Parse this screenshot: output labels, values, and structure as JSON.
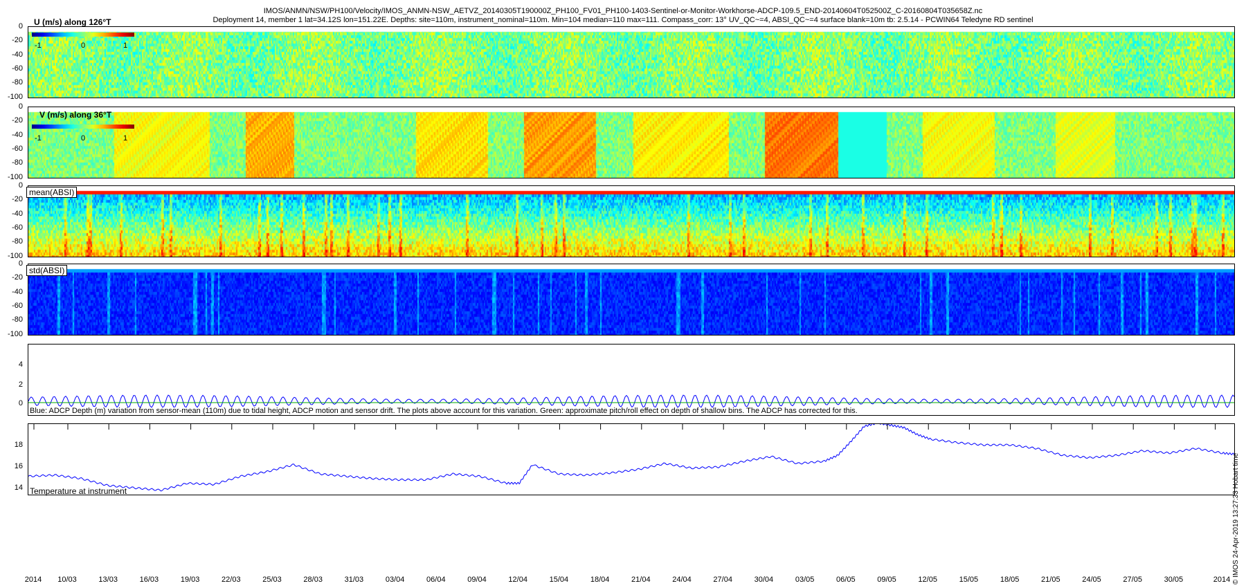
{
  "title_line1": "IMOS/ANMN/NSW/PH100/Velocity/IMOS_ANMN-NSW_AETVZ_20140305T190000Z_PH100_FV01_PH100-1403-Sentinel-or-Monitor-Workhorse-ADCP-109.5_END-20140604T052500Z_C-20160804T035658Z.nc",
  "title_line2": "Deployment 14, member 1 lat=34.12S lon=151.22E. Depths: site=110m, instrument_nominal=110m. Min=104 median=110 max=111. Compass_corr: 13° UV_QC~=4, ABSI_QC~=4 surface blank=10m tb: 2.5.14 - PCWIN64 Teledyne RD sentinel",
  "side_note": "© IMOS 24-Apr-2019 13:27:33 Hobart time",
  "panels": {
    "u": {
      "label": "U (m/s) along 126°T",
      "cbar_ticks": [
        "-1",
        "0",
        "1"
      ]
    },
    "v": {
      "label": "V (m/s) along 36°T",
      "cbar_ticks": [
        "-1",
        "0",
        "1"
      ]
    },
    "mean": {
      "label": "mean(ABSI)"
    },
    "std": {
      "label": "std(ABSI)"
    }
  },
  "depth_ticks": [
    "0",
    "-20",
    "-40",
    "-60",
    "-80",
    "-100"
  ],
  "depth_panel_ticks": [
    "4",
    "2",
    "0"
  ],
  "depth_caption": "Blue: ADCP Depth (m) variation from sensor-mean (110m) due to tidal height, ADCP motion and sensor drift. The plots above account for this variation. Green: approximate pitch/roll effect on depth of shallow bins. The ADCP has corrected for this.",
  "temp_panel_ticks": [
    "18",
    "16",
    "14"
  ],
  "temp_caption": "Temperature at instrument",
  "x_ticks": [
    "2014",
    "10/03",
    "13/03",
    "16/03",
    "19/03",
    "22/03",
    "25/03",
    "28/03",
    "31/03",
    "03/04",
    "06/04",
    "09/04",
    "12/04",
    "15/04",
    "18/04",
    "21/04",
    "24/04",
    "27/04",
    "30/04",
    "03/05",
    "06/05",
    "09/05",
    "12/05",
    "15/05",
    "18/05",
    "21/05",
    "24/05",
    "27/05",
    "30/05",
    "2014"
  ],
  "chart_data": [
    {
      "type": "heatmap",
      "title": "U (m/s) along 126°T",
      "ylim": [
        -100,
        0
      ],
      "clim": [
        -1,
        1
      ],
      "colormap": "jet",
      "note": "mostly near 0 (green) throughout"
    },
    {
      "type": "heatmap",
      "title": "V (m/s) along 36°T",
      "ylim": [
        -100,
        0
      ],
      "clim": [
        -1,
        1
      ],
      "colormap": "jet",
      "note": "episodic positive (yellow/orange) bands"
    },
    {
      "type": "heatmap",
      "title": "mean(ABSI)",
      "ylim": [
        -100,
        0
      ],
      "colormap": "jet"
    },
    {
      "type": "heatmap",
      "title": "std(ABSI)",
      "ylim": [
        -100,
        0
      ],
      "colormap": "jet"
    },
    {
      "type": "line",
      "ylabel": "",
      "ylim": [
        -1.2,
        5.5
      ],
      "series": [
        {
          "color": "#0000ff",
          "note": "tidal oscillation amplitude ~0.5-0.8 m around 0"
        },
        {
          "color": "#00aa00",
          "note": "near 0"
        }
      ]
    },
    {
      "type": "line",
      "ylim": [
        13.5,
        19.7
      ],
      "x_days": [
        0,
        2,
        4,
        6,
        8,
        10,
        12,
        14,
        16,
        18,
        20,
        22,
        24,
        26,
        28,
        30,
        32,
        34,
        36,
        37,
        38,
        40,
        42,
        44,
        46,
        48,
        50,
        52,
        54,
        56,
        58,
        60,
        61,
        62,
        63,
        64,
        65,
        66,
        67,
        68,
        70,
        72,
        74,
        76,
        78,
        80,
        82,
        84,
        86,
        88,
        90,
        91
      ],
      "values": [
        15.2,
        15.3,
        15.0,
        14.4,
        14.2,
        14.0,
        14.6,
        14.5,
        15.2,
        15.6,
        16.2,
        15.4,
        15.2,
        15.0,
        14.9,
        14.9,
        15.4,
        15.2,
        14.6,
        14.6,
        16.2,
        15.4,
        15.3,
        15.5,
        15.8,
        16.3,
        15.9,
        16.0,
        16.5,
        16.9,
        16.3,
        16.5,
        17.0,
        18.2,
        19.5,
        19.8,
        19.6,
        19.4,
        18.8,
        18.4,
        18.1,
        17.9,
        17.9,
        17.6,
        17.0,
        16.8,
        17.0,
        17.4,
        17.2,
        17.6,
        17.2,
        17.1
      ],
      "series_color": "#0000ff"
    }
  ]
}
